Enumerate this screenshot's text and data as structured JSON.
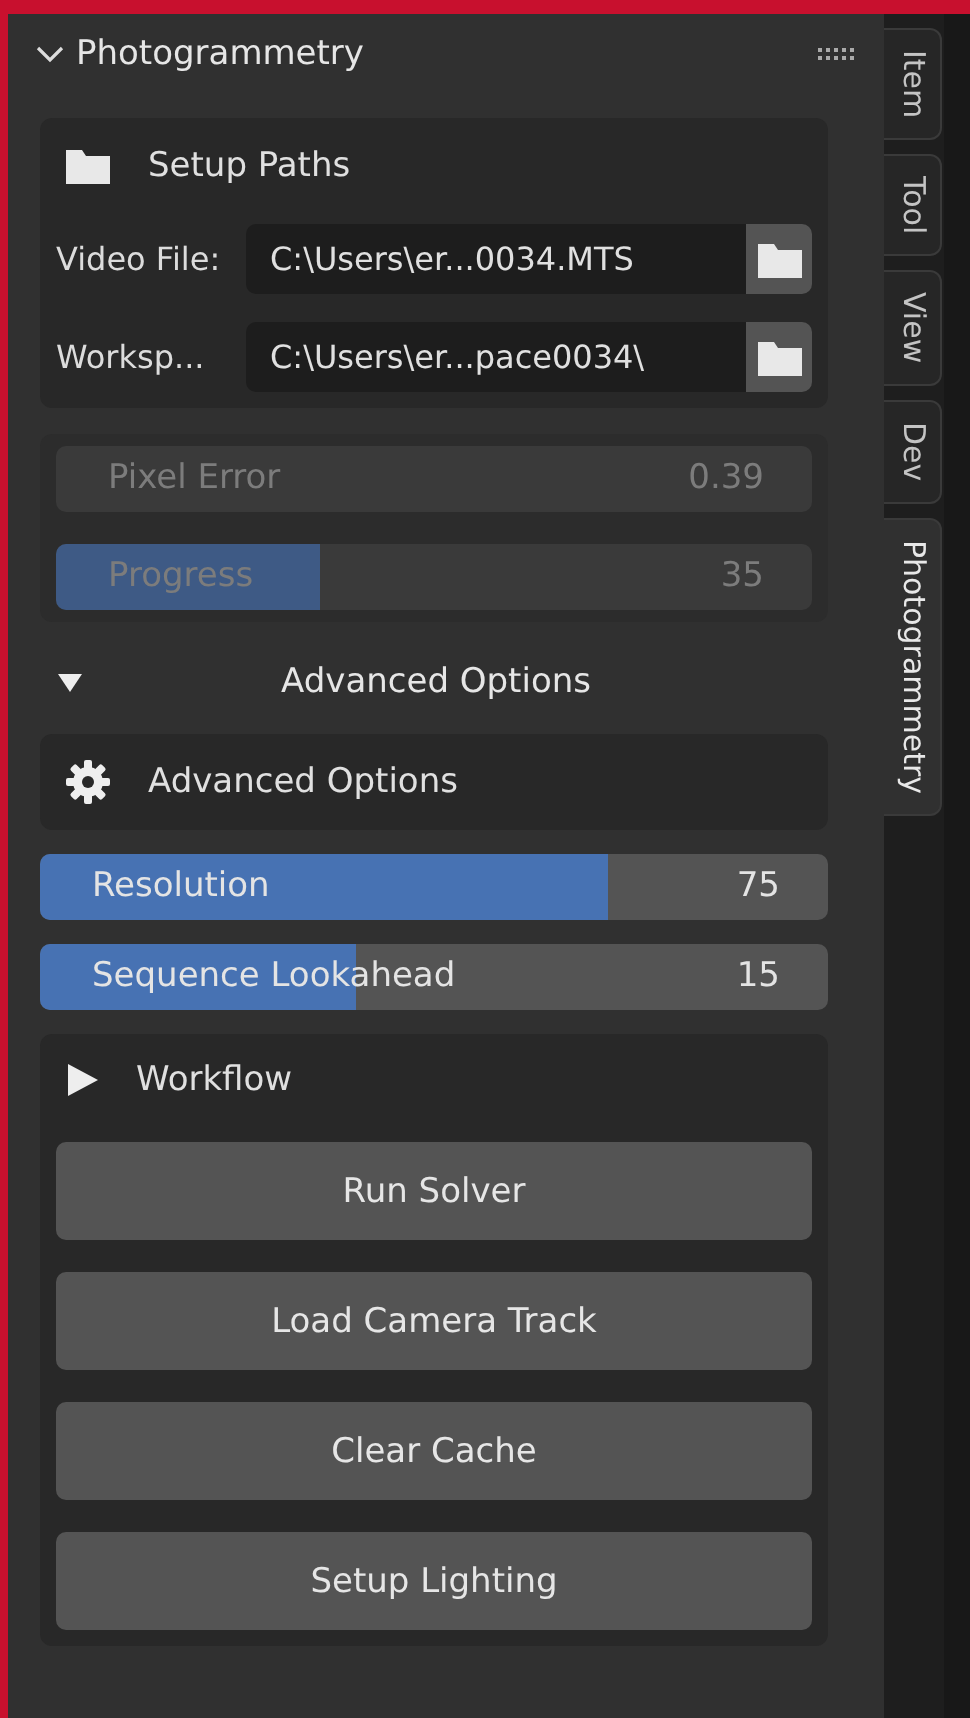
{
  "panel": {
    "title": "Photogrammetry",
    "expanded": true
  },
  "setup_paths": {
    "title": "Setup Paths",
    "fields": [
      {
        "label": "Video File:",
        "value": "C:\\Users\\er...0034.MTS"
      },
      {
        "label": "Worksp...",
        "value": "C:\\Users\\er...pace0034\\"
      }
    ]
  },
  "status": [
    {
      "label": "Pixel Error",
      "reading": "0.39",
      "disabled": true
    },
    {
      "label": "Progress",
      "reading": "35",
      "disabled": true,
      "level": 0.35
    }
  ],
  "advanced_subpanel": {
    "title": "Advanced Options",
    "expanded": true
  },
  "advanced_box": {
    "title": "Advanced Options"
  },
  "sliders": [
    {
      "label": "Resolution",
      "reading": "75",
      "level": 0.72
    },
    {
      "label": "Sequence Lookahead",
      "reading": "15",
      "level": 0.4
    }
  ],
  "workflow": {
    "title": "Workflow",
    "buttons": [
      "Run Solver",
      "Load Camera Track",
      "Clear Cache",
      "Setup Lighting"
    ]
  },
  "tabs": [
    {
      "label": "Item",
      "selected": false
    },
    {
      "label": "Tool",
      "selected": false
    },
    {
      "label": "View",
      "selected": false
    },
    {
      "label": "Dev",
      "selected": false
    },
    {
      "label": "Photogrammetry",
      "selected": true
    }
  ]
}
